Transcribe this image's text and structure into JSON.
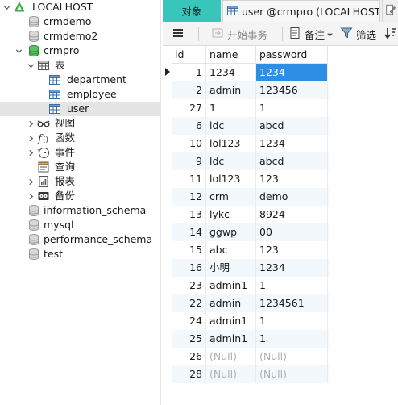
{
  "navigator": {
    "items": [
      {
        "label": "LOCALHOST",
        "icon": "connection-icon",
        "level": 0,
        "caret": "expanded"
      },
      {
        "label": "crmdemo",
        "icon": "database-icon-gray",
        "level": 1,
        "caret": "none"
      },
      {
        "label": "crmdemo2",
        "icon": "database-icon-gray",
        "level": 1,
        "caret": "none"
      },
      {
        "label": "crmpro",
        "icon": "database-icon-green",
        "level": 1,
        "caret": "expanded"
      },
      {
        "label": "表",
        "icon": "tables-folder-icon",
        "level": 2,
        "caret": "expanded"
      },
      {
        "label": "department",
        "icon": "table-icon",
        "level": 3,
        "caret": "none"
      },
      {
        "label": "employee",
        "icon": "table-icon",
        "level": 3,
        "caret": "none"
      },
      {
        "label": "user",
        "icon": "table-icon",
        "level": 3,
        "caret": "none",
        "selected": true
      },
      {
        "label": "视图",
        "icon": "views-icon",
        "level": 2,
        "caret": "collapsed"
      },
      {
        "label": "函数",
        "icon": "function-icon",
        "level": 2,
        "caret": "collapsed"
      },
      {
        "label": "事件",
        "icon": "event-icon",
        "level": 2,
        "caret": "collapsed"
      },
      {
        "label": "查询",
        "icon": "query-icon",
        "level": 2,
        "caret": "none"
      },
      {
        "label": "报表",
        "icon": "report-icon",
        "level": 2,
        "caret": "collapsed"
      },
      {
        "label": "备份",
        "icon": "backup-icon",
        "level": 2,
        "caret": "collapsed"
      },
      {
        "label": "information_schema",
        "icon": "database-icon-gray",
        "level": 1,
        "caret": "none"
      },
      {
        "label": "mysql",
        "icon": "database-icon-gray",
        "level": 1,
        "caret": "none"
      },
      {
        "label": "performance_schema",
        "icon": "database-icon-gray",
        "level": 1,
        "caret": "none"
      },
      {
        "label": "test",
        "icon": "database-icon-gray",
        "level": 1,
        "caret": "none"
      }
    ]
  },
  "tabs": {
    "objects": "对象",
    "user": "user @crmpro (LOCALHOST..."
  },
  "toolbar": {
    "begin_transaction": "开始事务",
    "memo": "备注",
    "filter": "筛选"
  },
  "grid": {
    "columns": [
      "id",
      "name",
      "password"
    ],
    "rows": [
      {
        "id": "1",
        "name": "1234",
        "password": "1234"
      },
      {
        "id": "2",
        "name": "admin",
        "password": "123456"
      },
      {
        "id": "27",
        "name": "1",
        "password": "1"
      },
      {
        "id": "6",
        "name": "ldc",
        "password": "abcd"
      },
      {
        "id": "10",
        "name": "lol123",
        "password": "1234"
      },
      {
        "id": "9",
        "name": "ldc",
        "password": "abcd"
      },
      {
        "id": "11",
        "name": "lol123",
        "password": "123"
      },
      {
        "id": "12",
        "name": "crm",
        "password": "demo"
      },
      {
        "id": "13",
        "name": "lykc",
        "password": "8924"
      },
      {
        "id": "14",
        "name": "ggwp",
        "password": "00"
      },
      {
        "id": "15",
        "name": "abc",
        "password": "123"
      },
      {
        "id": "16",
        "name": "小明",
        "password": "1234"
      },
      {
        "id": "23",
        "name": "admin1",
        "password": "1"
      },
      {
        "id": "22",
        "name": "admin",
        "password": "1234561"
      },
      {
        "id": "24",
        "name": "admin1",
        "password": "1"
      },
      {
        "id": "25",
        "name": "admin1",
        "password": "1"
      },
      {
        "id": "26",
        "name": "(Null)",
        "password": "(Null)"
      },
      {
        "id": "28",
        "name": "(Null)",
        "password": "(Null)"
      }
    ],
    "null_text": "(Null)",
    "active_cell": {
      "row": 0,
      "column": "password"
    }
  },
  "colors": {
    "tab_active_bg": "#38c5ba",
    "selection_blue": "#2d8ee6",
    "alt_row": "#f2f8fc",
    "db_green": "#3cb043",
    "null_text": "#b0b0b0"
  }
}
